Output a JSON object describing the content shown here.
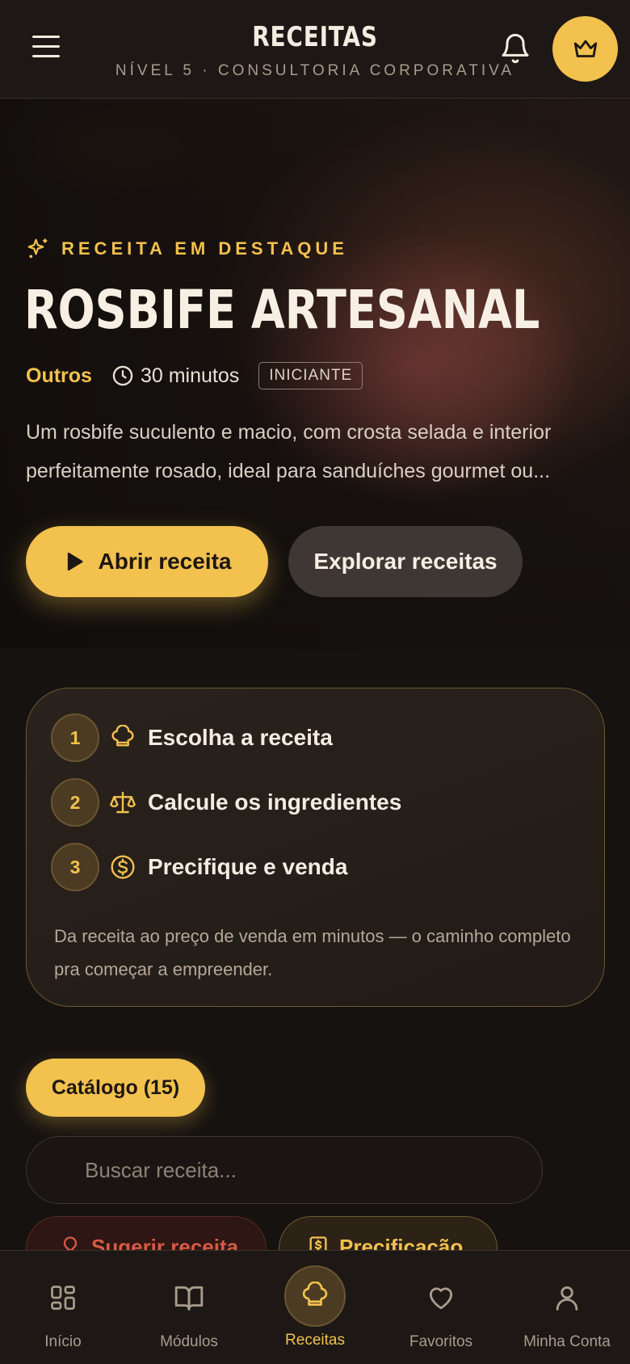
{
  "header": {
    "title": "RECEITAS",
    "subtitle": "NÍVEL 5 · CONSULTORIA CORPORATIVA",
    "icons": {
      "menu": "hamburger-menu-icon",
      "notifications": "bell-icon",
      "premium": "crown-icon"
    }
  },
  "hero": {
    "featured_label": "RECEITA EM DESTAQUE",
    "title": "ROSBIFE ARTESANAL",
    "category": "Outros",
    "time": "30 minutos",
    "level": "INICIANTE",
    "description": "Um rosbife suculento e macio, com crosta selada e interior perfeitamente rosado, ideal para sanduíches gourmet ou...",
    "primary_button": "Abrir receita",
    "secondary_button": "Explorar receitas"
  },
  "steps": {
    "items": [
      {
        "number": "1",
        "label": "Escolha a receita",
        "icon": "chef-hat-icon"
      },
      {
        "number": "2",
        "label": "Calcule os ingredientes",
        "icon": "scale-icon"
      },
      {
        "number": "3",
        "label": "Precifique e venda",
        "icon": "dollar-coin-icon"
      }
    ],
    "note": "Da receita ao preço de venda em minutos — o caminho completo pra começar a empreender."
  },
  "catalog": {
    "label": "Catálogo (15)",
    "search_placeholder": "Buscar receita...",
    "search_value": "",
    "chips": [
      {
        "label": "Sugerir receita",
        "icon": "lightbulb-icon"
      },
      {
        "label": "Precificação",
        "icon": "price-tag-icon"
      }
    ]
  },
  "bottom_nav": {
    "items": [
      {
        "label": "Início",
        "icon": "grid-icon"
      },
      {
        "label": "Módulos",
        "icon": "book-icon"
      },
      {
        "label": "Receitas",
        "icon": "chef-hat-icon",
        "active": true
      },
      {
        "label": "Favoritos",
        "icon": "heart-icon"
      },
      {
        "label": "Minha Conta",
        "icon": "user-icon"
      }
    ]
  },
  "colors": {
    "accent": "#f2c14e",
    "background": "#161210",
    "danger": "#d65a44"
  }
}
